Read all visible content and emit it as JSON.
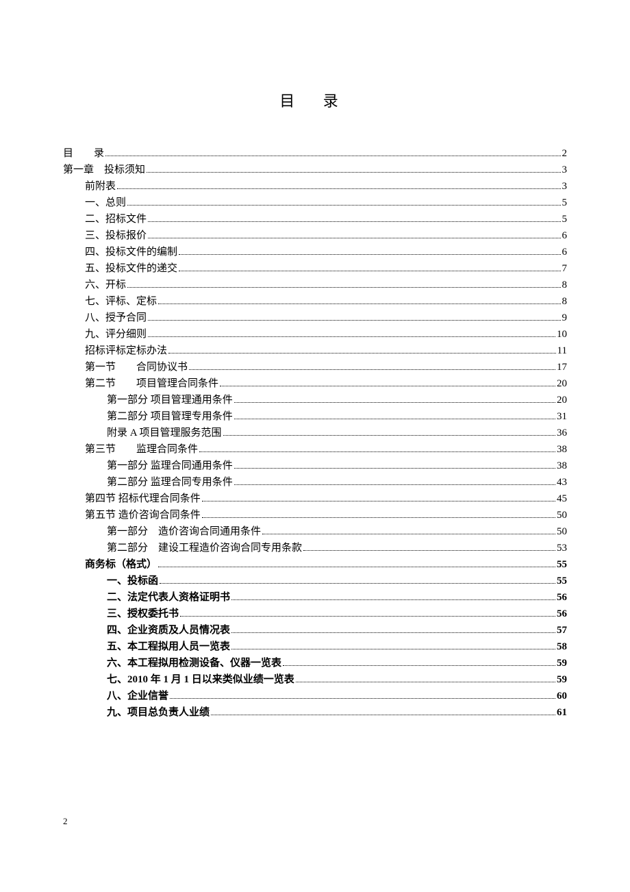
{
  "title": "目 录",
  "page_number": "2",
  "toc": [
    {
      "label": "目　　录",
      "page": "2",
      "indent": 0,
      "bold": false
    },
    {
      "label": "第一章　投标须知",
      "page": "3",
      "indent": 0,
      "bold": false
    },
    {
      "label": "前附表",
      "page": "3",
      "indent": 1,
      "bold": false
    },
    {
      "label": "一、总则",
      "page": "5",
      "indent": 1,
      "bold": false
    },
    {
      "label": "二、招标文件",
      "page": "5",
      "indent": 1,
      "bold": false
    },
    {
      "label": "三、投标报价",
      "page": "6",
      "indent": 1,
      "bold": false
    },
    {
      "label": "四、投标文件的编制",
      "page": "6",
      "indent": 1,
      "bold": false
    },
    {
      "label": "五、投标文件的递交",
      "page": "7",
      "indent": 1,
      "bold": false
    },
    {
      "label": "六、开标",
      "page": "8",
      "indent": 1,
      "bold": false
    },
    {
      "label": "七、评标、定标",
      "page": "8",
      "indent": 1,
      "bold": false
    },
    {
      "label": "八、授予合同",
      "page": "9",
      "indent": 1,
      "bold": false
    },
    {
      "label": "九、评分细则",
      "page": "10",
      "indent": 1,
      "bold": false
    },
    {
      "label": "招标评标定标办法",
      "page": "11",
      "indent": 1,
      "bold": false
    },
    {
      "label": "第一节　　合同协议书",
      "page": "17",
      "indent": 1,
      "bold": false
    },
    {
      "label": "第二节　　项目管理合同条件",
      "page": "20",
      "indent": 1,
      "bold": false
    },
    {
      "label": "第一部分  项目管理通用条件",
      "page": "20",
      "indent": 2,
      "bold": false
    },
    {
      "label": "第二部分  项目管理专用条件",
      "page": "31",
      "indent": 2,
      "bold": false
    },
    {
      "label": "附录 A  项目管理服务范围",
      "page": "36",
      "indent": 2,
      "bold": false
    },
    {
      "label": "第三节　　监理合同条件",
      "page": "38",
      "indent": 1,
      "bold": false
    },
    {
      "label": "第一部分  监理合同通用条件",
      "page": "38",
      "indent": 2,
      "bold": false
    },
    {
      "label": "第二部分  监理合同专用条件",
      "page": "43",
      "indent": 2,
      "bold": false
    },
    {
      "label": "第四节  招标代理合同条件",
      "page": "45",
      "indent": 1,
      "bold": false
    },
    {
      "label": "第五节  造价咨询合同条件",
      "page": "50",
      "indent": 1,
      "bold": false
    },
    {
      "label": "第一部分　造价咨询合同通用条件",
      "page": "50",
      "indent": 2,
      "bold": false
    },
    {
      "label": "第二部分　建设工程造价咨询合同专用条款",
      "page": " 53",
      "indent": 2,
      "bold": false
    },
    {
      "label": "商务标（格式）",
      "page": "55",
      "indent": 1,
      "bold": true
    },
    {
      "label": "一、投标函",
      "page": "55",
      "indent": 2,
      "bold": true
    },
    {
      "label": "二、法定代表人资格证明书",
      "page": " 56",
      "indent": 2,
      "bold": true
    },
    {
      "label": "三、授权委托书",
      "page": "56",
      "indent": 2,
      "bold": true
    },
    {
      "label": "四、企业资质及人员情况表",
      "page": " 57",
      "indent": 2,
      "bold": true
    },
    {
      "label": "五、本工程拟用人员一览表",
      "page": " 58",
      "indent": 2,
      "bold": true
    },
    {
      "label": "六、本工程拟用检测设备、仪器一览表",
      "page": "59",
      "indent": 2,
      "bold": true
    },
    {
      "label": "七、2010 年 1 月 1 日以来类似业绩一览表",
      "page": " 59",
      "indent": 2,
      "bold": true
    },
    {
      "label": "八、企业信誉",
      "page": " 60",
      "indent": 2,
      "bold": true
    },
    {
      "label": "九、项目总负责人业绩",
      "page": "61",
      "indent": 2,
      "bold": true
    }
  ]
}
